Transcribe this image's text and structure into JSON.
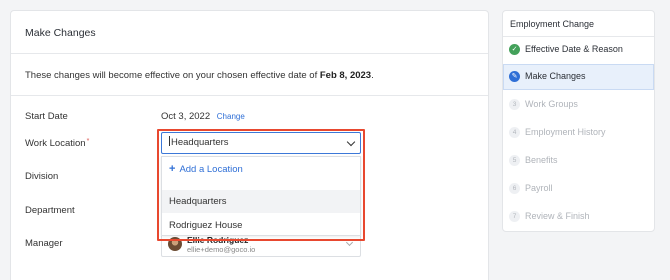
{
  "main": {
    "title": "Make Changes",
    "notice_text": "These changes will become effective on your chosen effective date of",
    "notice_date": "Feb 8, 2023",
    "notice_end": ".",
    "fields": {
      "start_date_label": "Start Date",
      "start_date_value": "Oct 3, 2022",
      "change_link": "Change",
      "work_location_label": "Work Location",
      "required_mark": "*",
      "work_location_value": "Headquarters",
      "division_label": "Division",
      "department_label": "Department",
      "manager_label": "Manager"
    },
    "location_dropdown": {
      "add_label": "Add a Location",
      "options": [
        "Headquarters",
        "Rodriguez House"
      ],
      "hovered_option": "Headquarters"
    },
    "manager": {
      "name": "Ellie Rodriguez",
      "email": "ellie+demo@goco.io"
    }
  },
  "sidebar": {
    "title": "Employment Change",
    "steps": [
      {
        "label": "Effective Date & Reason",
        "state": "done",
        "marker": "✓"
      },
      {
        "label": "Make Changes",
        "state": "current",
        "marker": "✎"
      },
      {
        "label": "Work Groups",
        "state": "pending",
        "marker": "3"
      },
      {
        "label": "Employment History",
        "state": "pending",
        "marker": "4"
      },
      {
        "label": "Benefits",
        "state": "pending",
        "marker": "5"
      },
      {
        "label": "Payroll",
        "state": "pending",
        "marker": "6"
      },
      {
        "label": "Review & Finish",
        "state": "pending",
        "marker": "7"
      }
    ]
  },
  "colors": {
    "accent": "#2f6fd6",
    "success": "#43a15a",
    "highlight": "#e8482f"
  }
}
